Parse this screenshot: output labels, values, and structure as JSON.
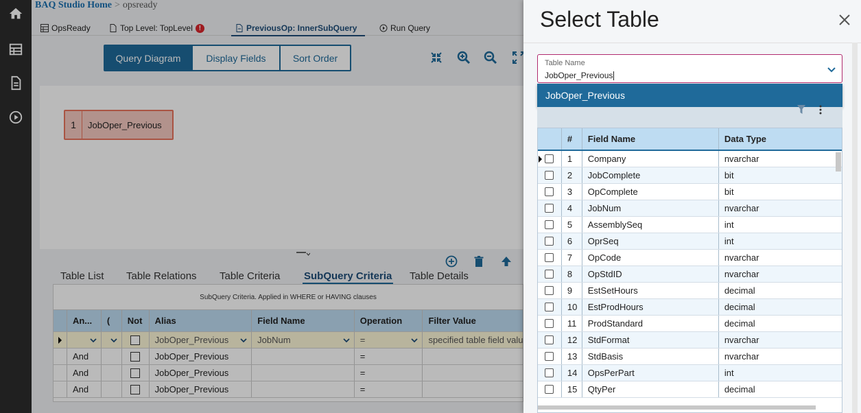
{
  "breadcrumb": {
    "home": "BAQ Studio Home",
    "separator": ">",
    "current": "opsready"
  },
  "top_tabs": [
    {
      "label": "OpsReady"
    },
    {
      "label": "Top Level: TopLevel",
      "badge": "!"
    },
    {
      "label": "PreviousOp: InnerSubQuery"
    },
    {
      "label": "Run Query"
    }
  ],
  "view_buttons": [
    "Query Diagram",
    "Display Fields",
    "Sort Order"
  ],
  "diagram_node": {
    "number": "1",
    "name": "JobOper_Previous"
  },
  "sub_tabs": [
    "Table List",
    "Table Relations",
    "Table Criteria",
    "SubQuery Criteria",
    "Table Details"
  ],
  "criteria_grid": {
    "caption": "SubQuery Criteria. Applied in WHERE or HAVING clauses",
    "headers": [
      "An...",
      "(",
      "Not",
      "Alias",
      "Field Name",
      "Operation",
      "Filter Value"
    ],
    "edit_row": {
      "alias": "JobOper_Previous",
      "field": "JobNum",
      "operation": "=",
      "filter": "specified  table field value"
    },
    "rows": [
      {
        "andor": "And",
        "alias": "JobOper_Previous",
        "operation": "="
      },
      {
        "andor": "And",
        "alias": "JobOper_Previous",
        "operation": "="
      },
      {
        "andor": "And",
        "alias": "JobOper_Previous",
        "operation": "="
      }
    ]
  },
  "panel": {
    "title": "Select Table",
    "table_name_label": "Table Name",
    "table_name_value": "JobOper_Previous",
    "option": "JobOper_Previous",
    "fields_table": {
      "headers": [
        "#",
        "Field Name",
        "Data Type"
      ],
      "rows": [
        {
          "num": "1",
          "name": "Company",
          "type": "nvarchar"
        },
        {
          "num": "2",
          "name": "JobComplete",
          "type": "bit"
        },
        {
          "num": "3",
          "name": "OpComplete",
          "type": "bit"
        },
        {
          "num": "4",
          "name": "JobNum",
          "type": "nvarchar"
        },
        {
          "num": "5",
          "name": "AssemblySeq",
          "type": "int"
        },
        {
          "num": "6",
          "name": "OprSeq",
          "type": "int"
        },
        {
          "num": "7",
          "name": "OpCode",
          "type": "nvarchar"
        },
        {
          "num": "8",
          "name": "OpStdID",
          "type": "nvarchar"
        },
        {
          "num": "9",
          "name": "EstSetHours",
          "type": "decimal"
        },
        {
          "num": "10",
          "name": "EstProdHours",
          "type": "decimal"
        },
        {
          "num": "11",
          "name": "ProdStandard",
          "type": "decimal"
        },
        {
          "num": "12",
          "name": "StdFormat",
          "type": "nvarchar"
        },
        {
          "num": "13",
          "name": "StdBasis",
          "type": "nvarchar"
        },
        {
          "num": "14",
          "name": "OpsPerPart",
          "type": "int"
        },
        {
          "num": "15",
          "name": "QtyPer",
          "type": "decimal"
        }
      ]
    }
  }
}
